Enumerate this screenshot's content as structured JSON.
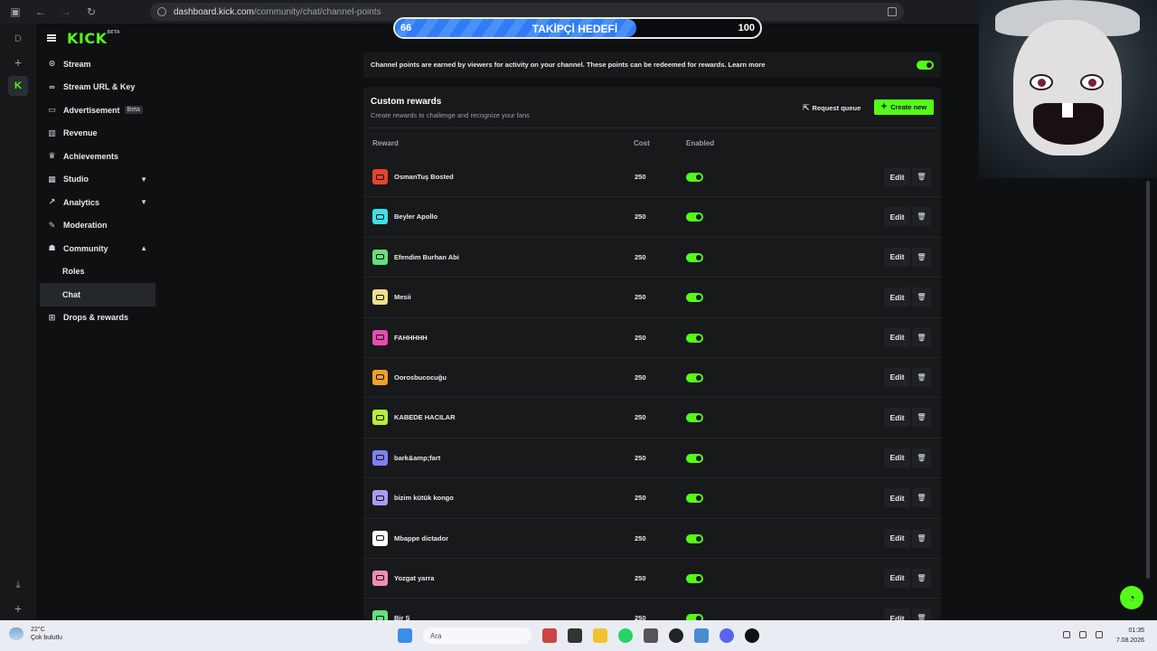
{
  "browser": {
    "url_host": "dashboard.kick.com",
    "url_path": "/community/chat/channel-points"
  },
  "rail": {
    "letter": "D",
    "plus": "+",
    "kick": "K"
  },
  "sidebar": {
    "logo": "KICK",
    "logo_tag": "BETA",
    "items": [
      {
        "label": "Stream"
      },
      {
        "label": "Stream URL & Key"
      },
      {
        "label": "Advertisement",
        "badge": "Beta"
      },
      {
        "label": "Revenue"
      },
      {
        "label": "Achievements"
      },
      {
        "label": "Studio"
      },
      {
        "label": "Analytics"
      },
      {
        "label": "Moderation"
      },
      {
        "label": "Community"
      },
      {
        "label": "Roles"
      },
      {
        "label": "Chat"
      },
      {
        "label": "Drops & rewards"
      }
    ]
  },
  "goal": {
    "start": "66",
    "title": "TAKİPÇİ HEDEFİ",
    "end": "100",
    "progress": 0.66
  },
  "info": {
    "text": "Channel points are earned by viewers for activity on your channel. These points can be redeemed for rewards. Learn more",
    "enabled": true
  },
  "rewards": {
    "title": "Custom rewards",
    "subtitle": "Create rewards to challenge and recognize your fans",
    "request_queue": "Request queue",
    "create_new": "Create new",
    "columns": {
      "reward": "Reward",
      "cost": "Cost",
      "enabled": "Enabled"
    },
    "edit_label": "Edit",
    "delete_icon": "trash-icon",
    "rows": [
      {
        "name": "OsmanTuş Bosted",
        "cost": "250",
        "color": "#e8432f"
      },
      {
        "name": "Beyler Apollo",
        "cost": "250",
        "color": "#3fe0e8"
      },
      {
        "name": "Efendim Burhan Abi",
        "cost": "250",
        "color": "#64e07a"
      },
      {
        "name": "Mesii",
        "cost": "250",
        "color": "#efe08f"
      },
      {
        "name": "FAHHHHH",
        "cost": "250",
        "color": "#e84bb0"
      },
      {
        "name": "Oorosbucocuğu",
        "cost": "250",
        "color": "#f0a02a"
      },
      {
        "name": "KABEDE HACILAR",
        "cost": "250",
        "color": "#b5ef3a"
      },
      {
        "name": "bark&amp;fart",
        "cost": "250",
        "color": "#7d80f0"
      },
      {
        "name": "bizim kütük kongo",
        "cost": "250",
        "color": "#a89cf2"
      },
      {
        "name": "Mbappe dictador",
        "cost": "250",
        "color": "#ffffff"
      },
      {
        "name": "Yozgat yarra",
        "cost": "250",
        "color": "#f28bb8"
      },
      {
        "name": "Bir S",
        "cost": "250",
        "color": "#64e07a"
      }
    ]
  },
  "taskbar": {
    "temp": "22°C",
    "weather": "Çok bulutlu",
    "search": "Ara",
    "time": "01:35",
    "date": "7.08.2026"
  }
}
